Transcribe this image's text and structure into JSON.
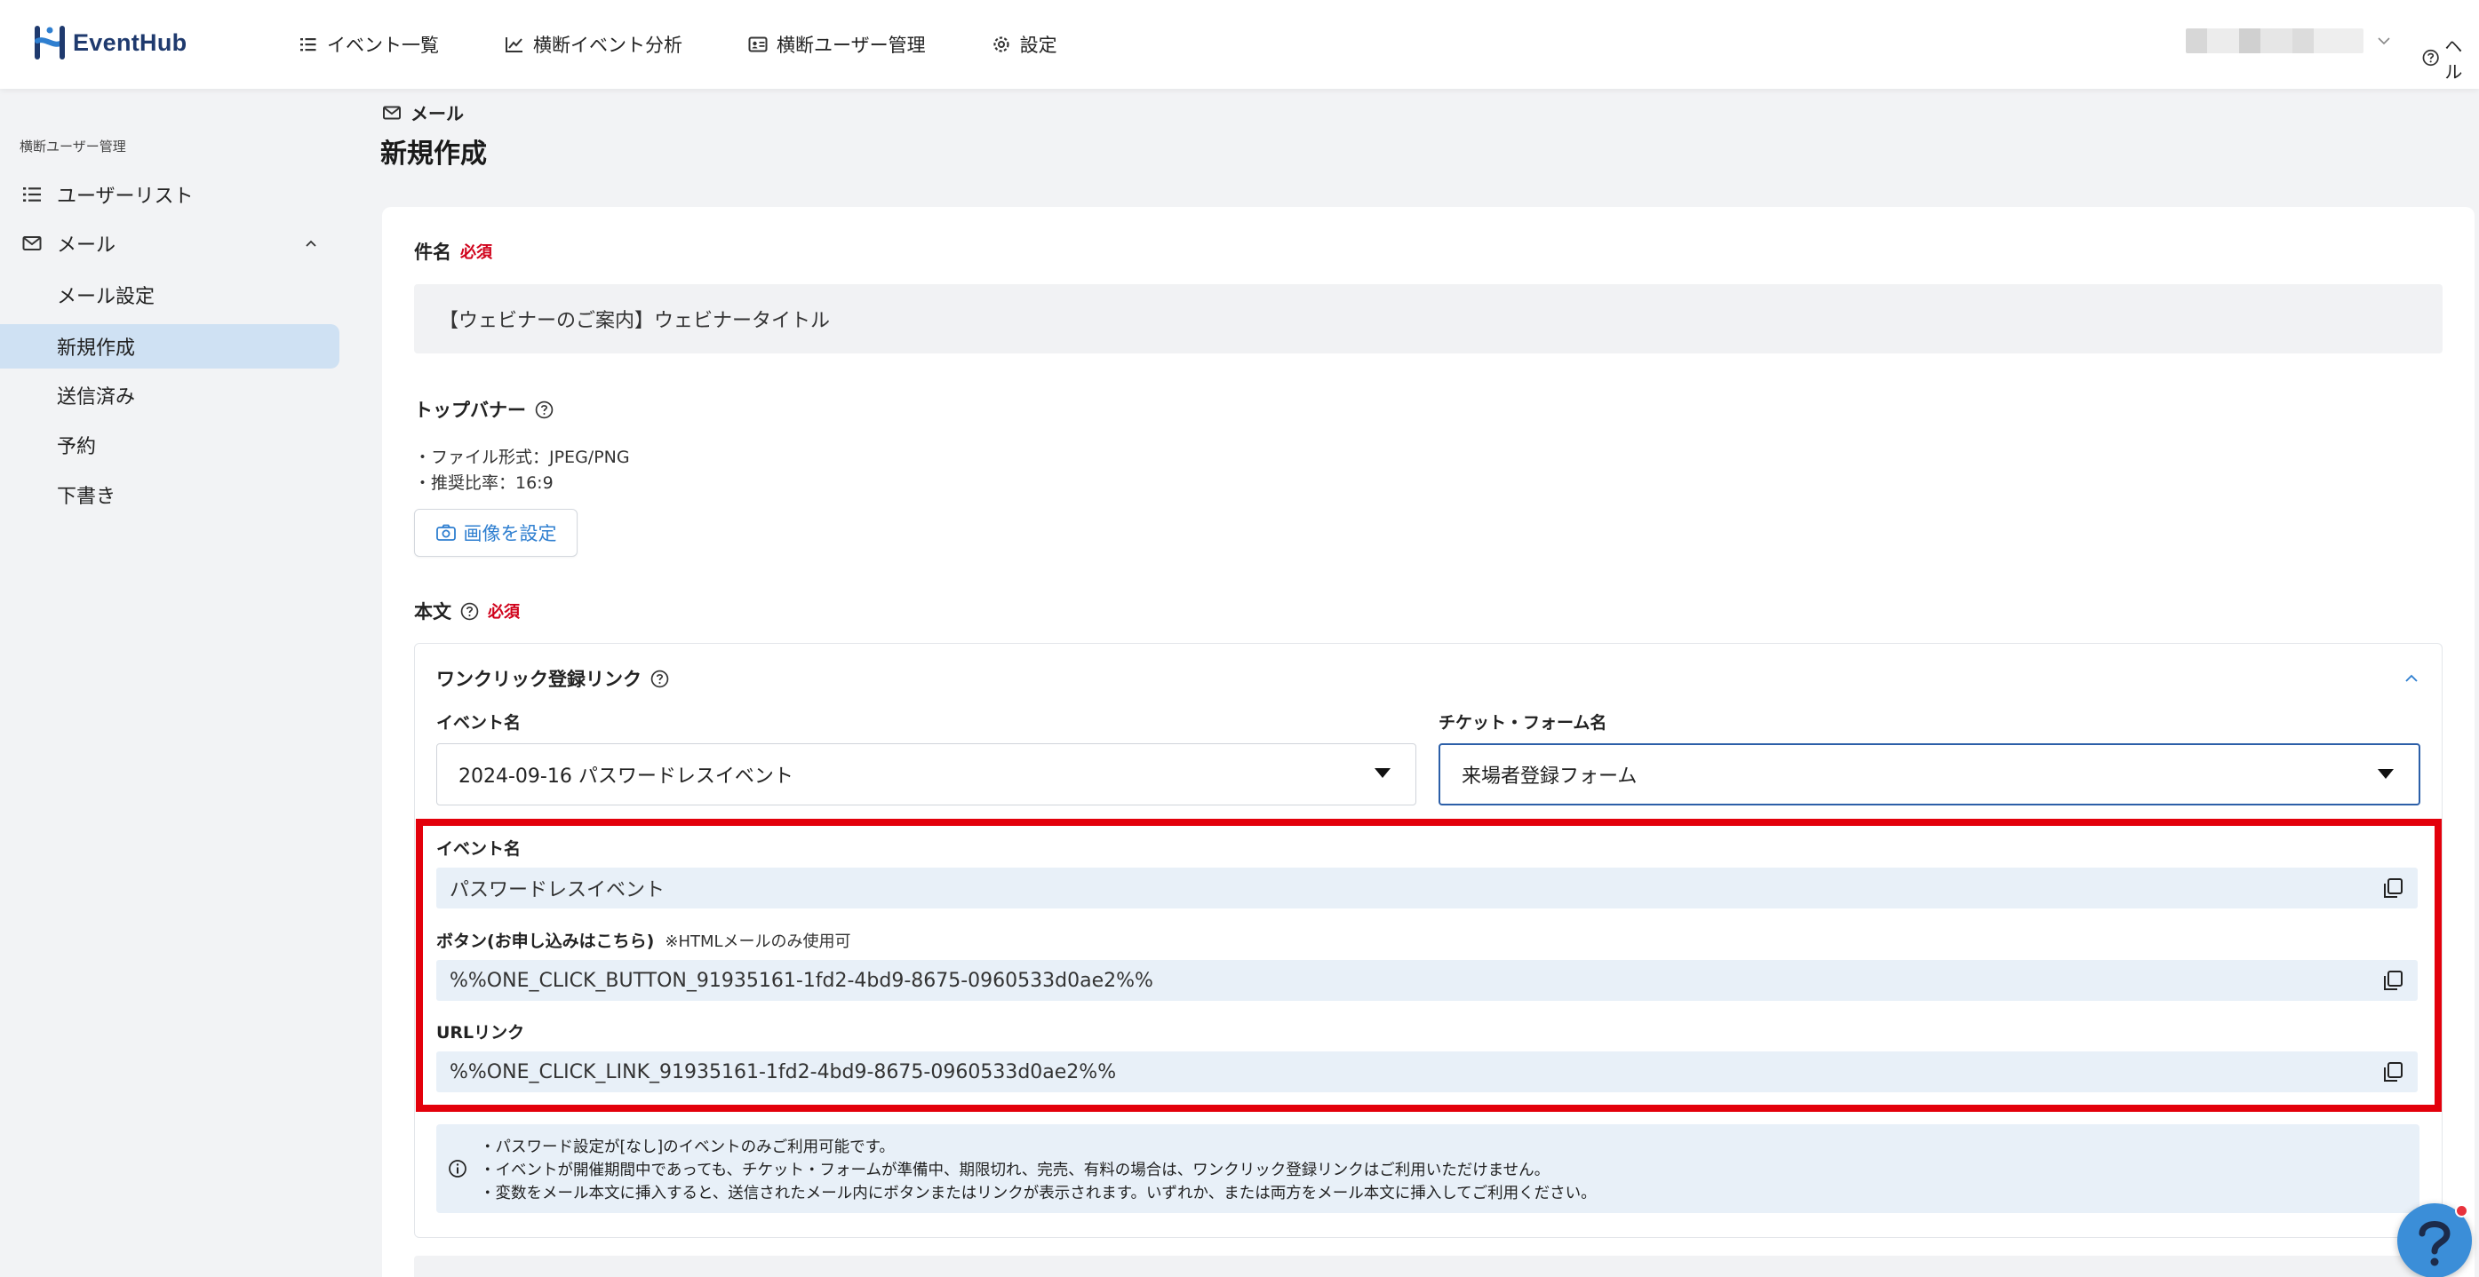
{
  "app": {
    "name": "EventHub"
  },
  "header": {
    "nav": [
      {
        "label": "イベント一覧",
        "icon": "list-icon"
      },
      {
        "label": "横断イベント分析",
        "icon": "chart-line-icon"
      },
      {
        "label": "横断ユーザー管理",
        "icon": "id-card-icon"
      },
      {
        "label": "設定",
        "icon": "gear-icon"
      }
    ],
    "help_label": "ヘル"
  },
  "sidebar": {
    "section_title": "横断ユーザー管理",
    "user_list": "ユーザーリスト",
    "mail": "メール",
    "mail_items": [
      "メール設定",
      "新規作成",
      "送信済み",
      "予約",
      "下書き"
    ],
    "active_item": "新規作成"
  },
  "breadcrumb": {
    "label": "メール",
    "icon": "mail-icon"
  },
  "page_title": "新規作成",
  "form": {
    "subject_label": "件名",
    "required_badge": "必須",
    "subject_value": "【ウェビナーのご案内】ウェビナータイトル",
    "top_banner_label": "トップバナー",
    "banner_notes": [
      "・ファイル形式：JPEG/PNG",
      "・推奨比率：16:9"
    ],
    "set_image_button": "画像を設定",
    "body_label": "本文",
    "one_click": {
      "title": "ワンクリック登録リンク",
      "event_label": "イベント名",
      "event_value": "2024-09-16 パスワードレスイベント",
      "ticket_label": "チケット・フォーム名",
      "ticket_value": "来場者登録フォーム",
      "variables": {
        "event_name_label": "イベント名",
        "event_name_value": "パスワードレスイベント",
        "button_label": "ボタン(お申し込みはこちら)",
        "button_note": "※HTMLメールのみ使用可",
        "button_value": "%%ONE_CLICK_BUTTON_91935161-1fd2-4bd9-8675-0960533d0ae2%%",
        "url_label": "URLリンク",
        "url_value": "%%ONE_CLICK_LINK_91935161-1fd2-4bd9-8675-0960533d0ae2%%"
      },
      "info_lines": [
        "・パスワード設定が[なし]のイベントのみご利用可能です。",
        "・イベントが開催期間中であっても、チケット・フォームが準備中、期限切れ、完売、有料の場合は、ワンクリック登録リンクはご利用いただけません。",
        "・変数をメール本文に挿入すると、送信されたメール内にボタンまたはリンクが表示されます。いずれか、または両方をメール本文に挿入してご利用ください。"
      ]
    }
  },
  "colors": {
    "accent": "#2f7fd0",
    "active_bg": "#cfe1f3",
    "required": "#d0021b",
    "highlight_box": "#e3000b",
    "field_bg": "#e8f0f8"
  }
}
